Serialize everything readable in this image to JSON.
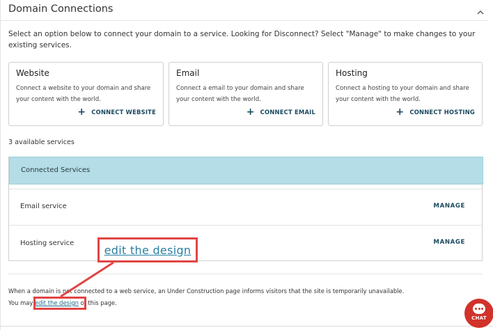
{
  "header": {
    "title": "Domain Connections"
  },
  "intro": "Select an option below to connect your domain to a service. Looking for Disconnect? Select \"Manage\" to make changes to your existing services.",
  "cards": [
    {
      "title": "Website",
      "desc": "Connect a website to your domain and share your content with the world.",
      "action": "CONNECT WEBSITE"
    },
    {
      "title": "Email",
      "desc": "Connect a email to your domain and share your content with the world.",
      "action": "CONNECT EMAIL"
    },
    {
      "title": "Hosting",
      "desc": "Connect a hosting to your domain and share your content with the world.",
      "action": "CONNECT HOSTING"
    }
  ],
  "available": "3 available services",
  "connected": {
    "header": "Connected Services",
    "rows": [
      {
        "label": "Email service",
        "action": "MANAGE"
      },
      {
        "label": "Hosting service",
        "action": "MANAGE"
      }
    ]
  },
  "footer": {
    "line1": "When a domain is not connected to a web service, an Under Construction page informs visitors that the site is temporarily unavailable.",
    "prefix": "You may ",
    "link": "edit the design",
    "suffix": " of this page."
  },
  "callout": {
    "text": "edit the design"
  },
  "chat": {
    "label": "CHAT"
  },
  "colors": {
    "accent": "#1b4a60",
    "header_bg": "#b4dde7",
    "highlight": "#e04545",
    "chat": "#d1322a"
  }
}
